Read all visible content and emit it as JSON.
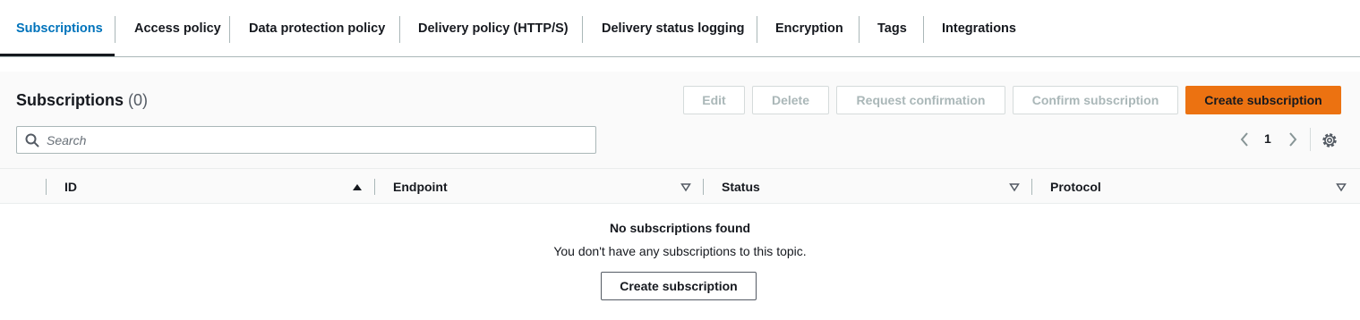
{
  "tabs": [
    {
      "label": "Subscriptions",
      "active": true
    },
    {
      "label": "Access policy"
    },
    {
      "label": "Data protection policy"
    },
    {
      "label": "Delivery policy (HTTP/S)"
    },
    {
      "label": "Delivery status logging"
    },
    {
      "label": "Encryption"
    },
    {
      "label": "Tags"
    },
    {
      "label": "Integrations"
    }
  ],
  "panel": {
    "title": "Subscriptions",
    "count": "(0)"
  },
  "actions": {
    "edit": "Edit",
    "delete": "Delete",
    "request_confirmation": "Request confirmation",
    "confirm_subscription": "Confirm subscription",
    "create_subscription": "Create subscription"
  },
  "search": {
    "placeholder": "Search",
    "value": ""
  },
  "pagination": {
    "current_page": "1"
  },
  "table": {
    "columns": [
      "ID",
      "Endpoint",
      "Status",
      "Protocol"
    ],
    "sorted_column": "ID",
    "sort_direction": "ascending",
    "rows": []
  },
  "empty_state": {
    "title": "No subscriptions found",
    "description": "You don't have any subscriptions to this topic.",
    "button": "Create subscription"
  },
  "colors": {
    "accent": "#0073bb",
    "primary_button": "#ec7211",
    "border": "#aab7b8",
    "panel_bg": "#fafafa"
  },
  "icons": {
    "search": "search-icon",
    "prev": "chevron-left-icon",
    "next": "chevron-right-icon",
    "settings": "gear-icon",
    "sort_asc": "caret-up-icon",
    "sort_none": "caret-down-outline-icon"
  }
}
